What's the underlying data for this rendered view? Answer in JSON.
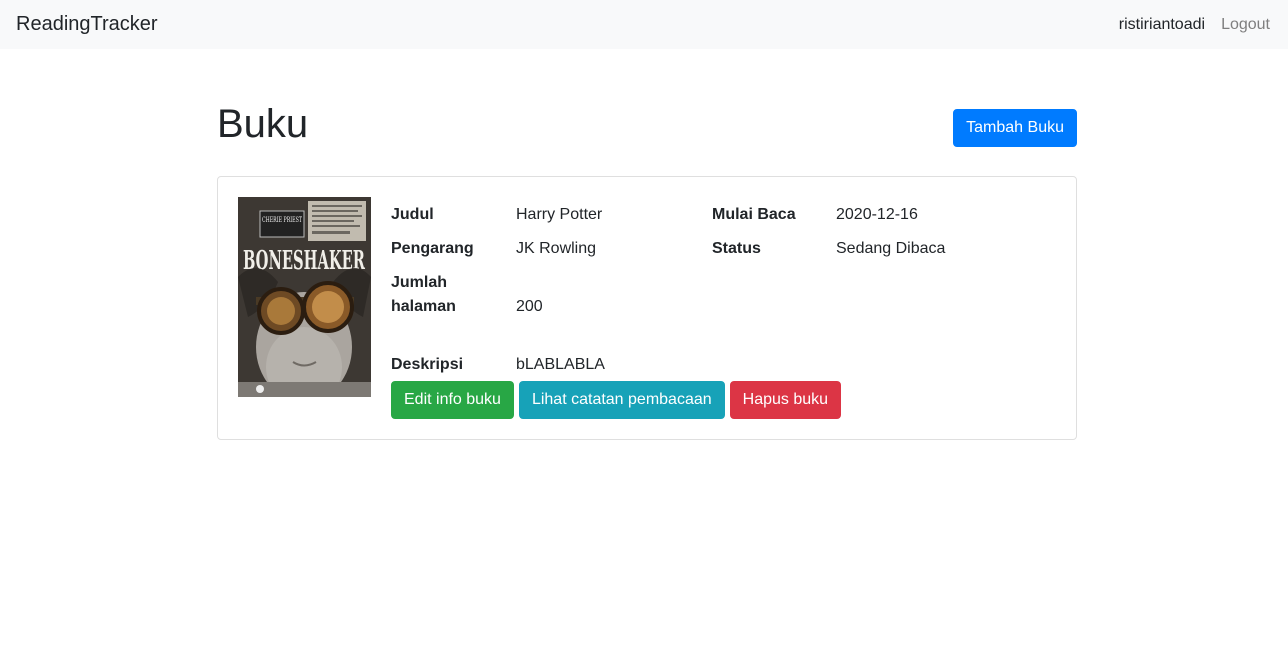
{
  "navbar": {
    "brand": "ReadingTracker",
    "username": "ristiriantoadi",
    "logout": "Logout"
  },
  "page": {
    "title": "Buku",
    "add_button": "Tambah Buku"
  },
  "book": {
    "cover_title": "BONESHAKER",
    "cover_author": "CHERIE PRIEST",
    "fields": {
      "title_label": "Judul",
      "title_value": "Harry Potter",
      "author_label": "Pengarang",
      "author_value": "JK Rowling",
      "pages_label_1": "Jumlah",
      "pages_label_2": "halaman",
      "pages_value": "200",
      "desc_label": "Deskripsi",
      "desc_value": "bLABLABLA",
      "start_label": "Mulai Baca",
      "start_value": "2020-12-16",
      "status_label": "Status",
      "status_value": "Sedang Dibaca"
    },
    "actions": {
      "edit": "Edit info buku",
      "notes": "Lihat catatan pembacaan",
      "delete": "Hapus buku"
    }
  },
  "colors": {
    "primary": "#007bff",
    "success": "#28a745",
    "info": "#17a2b8",
    "danger": "#dc3545"
  }
}
